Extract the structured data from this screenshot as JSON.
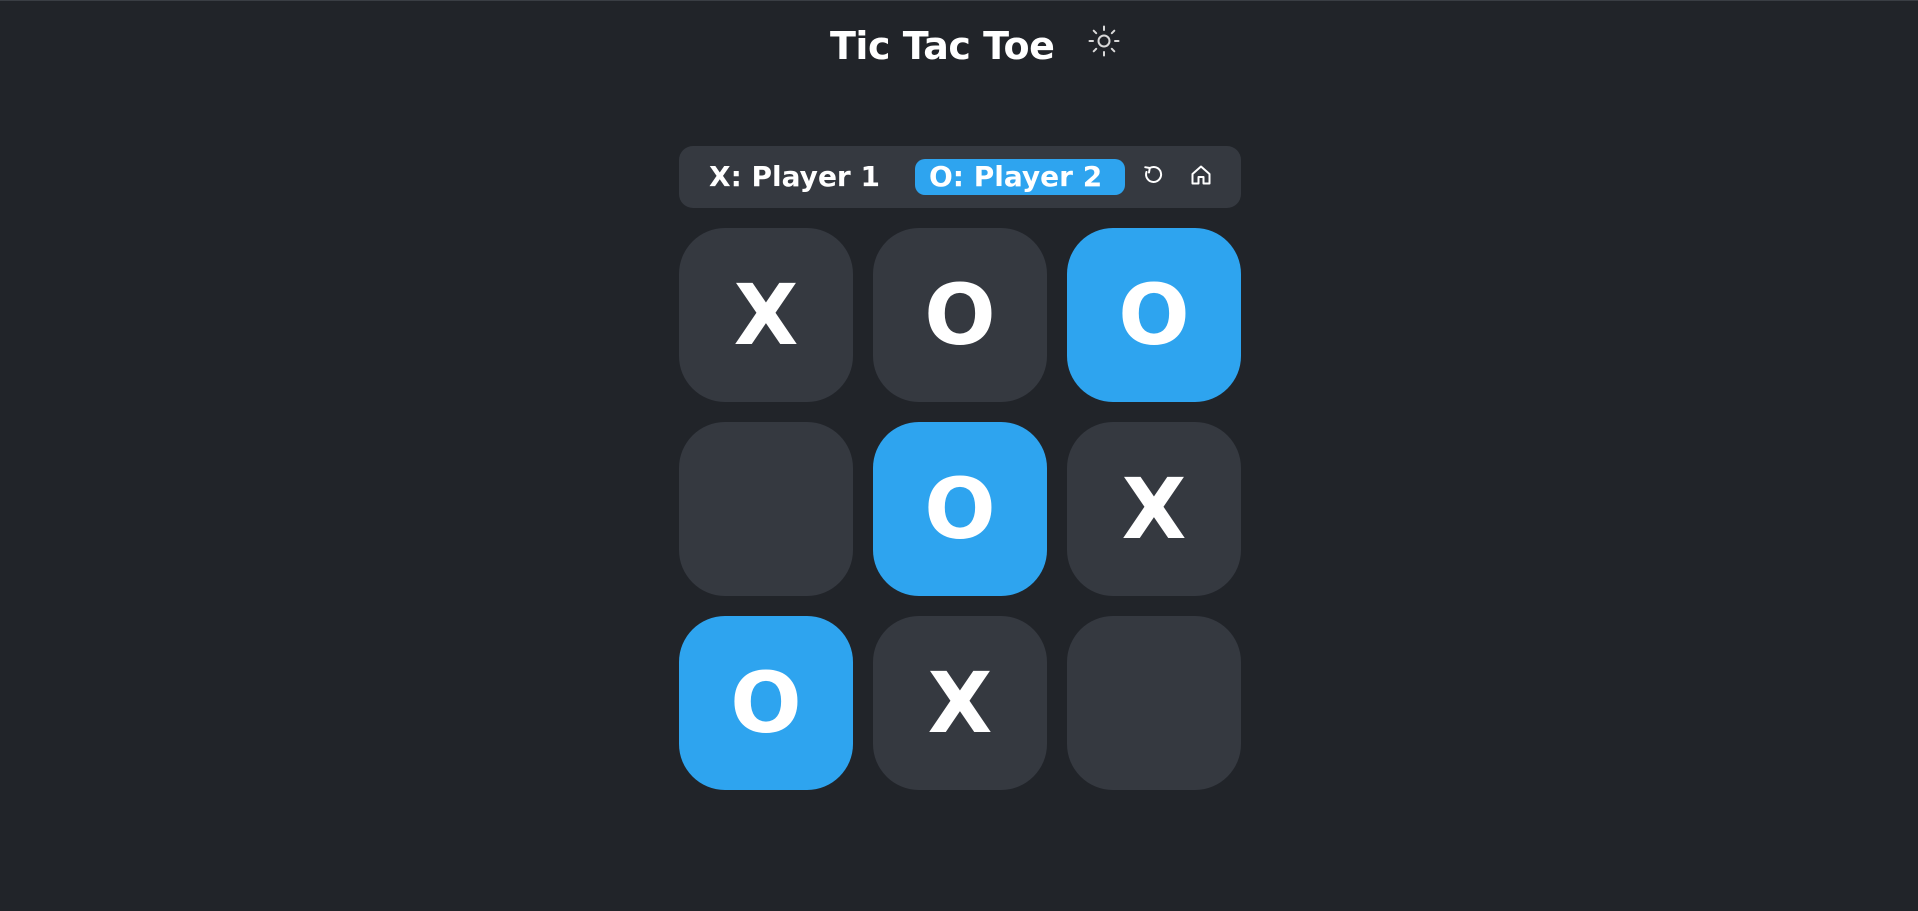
{
  "app": {
    "title": "Tic Tac Toe",
    "theme_toggle_icon": "sun-icon"
  },
  "status": {
    "player_x_label": "X: Player 1",
    "player_o_label": "O: Player 2",
    "active_player": "O",
    "restart_icon": "restart-icon",
    "home_icon": "home-icon"
  },
  "board": {
    "cells": [
      {
        "mark": "X",
        "highlighted": false
      },
      {
        "mark": "O",
        "highlighted": false
      },
      {
        "mark": "O",
        "highlighted": true
      },
      {
        "mark": "",
        "highlighted": false
      },
      {
        "mark": "O",
        "highlighted": true
      },
      {
        "mark": "X",
        "highlighted": false
      },
      {
        "mark": "O",
        "highlighted": true
      },
      {
        "mark": "X",
        "highlighted": false
      },
      {
        "mark": "",
        "highlighted": false
      }
    ]
  },
  "colors": {
    "background": "#212429",
    "panel": "#353940",
    "accent": "#2ea4ef",
    "text": "#ffffff"
  }
}
